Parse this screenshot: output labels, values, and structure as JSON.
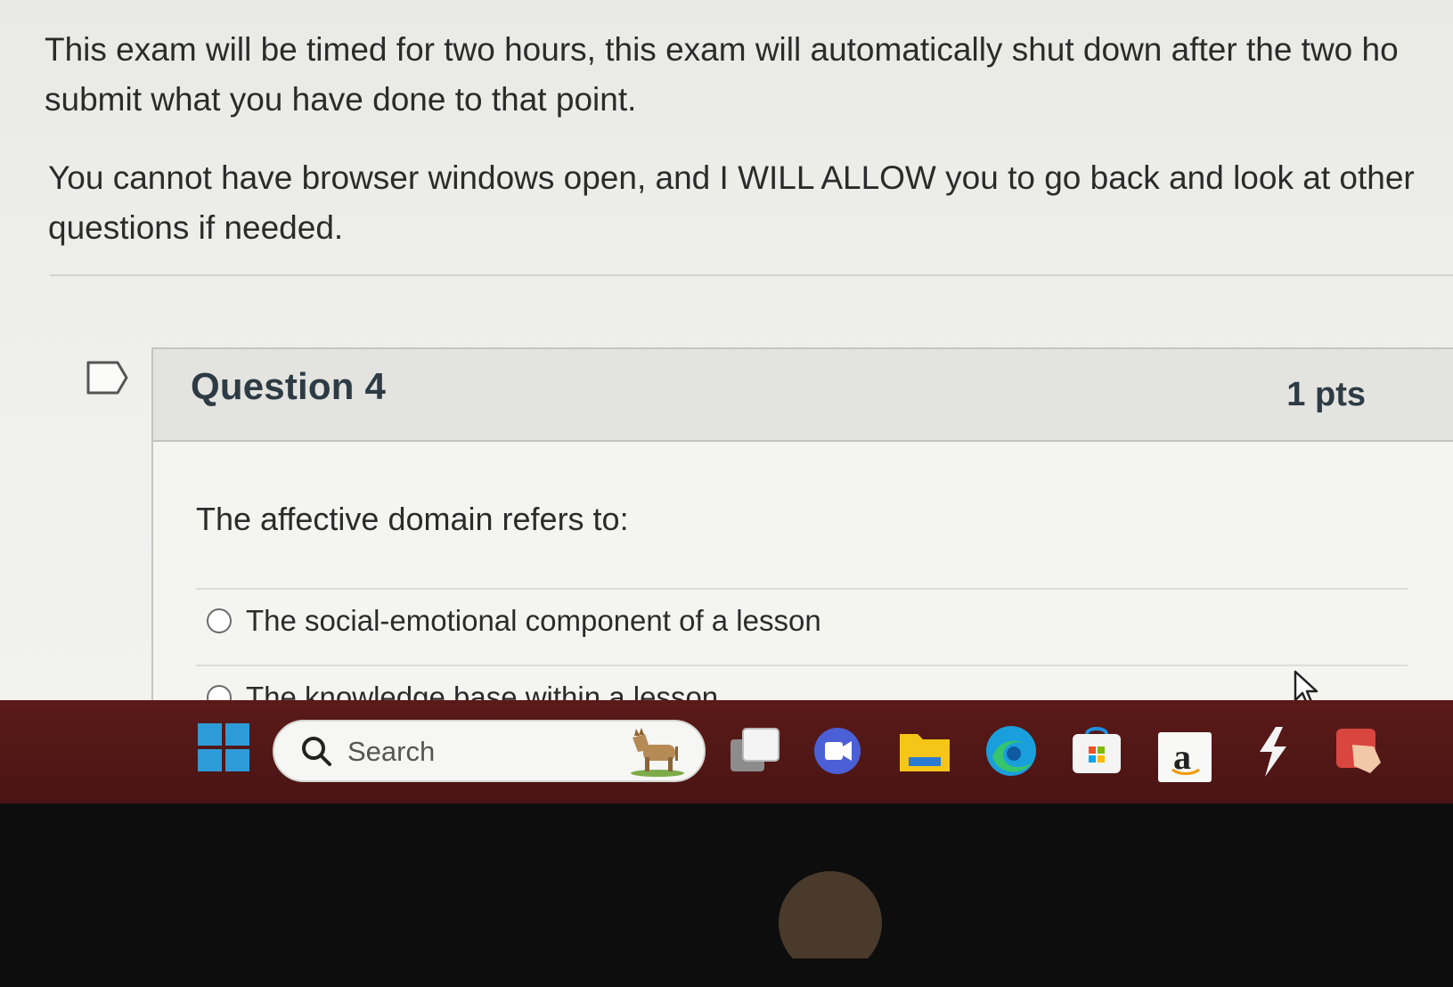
{
  "instructions": {
    "paragraph_1_line_1": "This exam will be timed for two hours, this exam will automatically shut down after the two ho",
    "paragraph_1_line_2": "submit what you have done to that point.",
    "paragraph_2_line_1": "You cannot have browser windows open, and I WILL ALLOW you to go back and look at other",
    "paragraph_2_line_2": "questions if needed."
  },
  "question": {
    "title": "Question 4",
    "points": "1 pts",
    "text": "The affective domain refers to:",
    "answers": [
      {
        "label": "The social-emotional component of a lesson"
      },
      {
        "label": "The knowledge base within a lesson"
      }
    ]
  },
  "taskbar": {
    "search_placeholder": "Search",
    "icons": [
      "windows-start-icon",
      "search-icon",
      "search-highlight-donkey-icon",
      "task-view-icon",
      "meet-video-icon",
      "file-explorer-icon",
      "edge-browser-icon",
      "microsoft-store-icon",
      "amazon-icon",
      "lightning-app-icon",
      "pinned-app-icon"
    ],
    "amazon_label": "a"
  },
  "colors": {
    "taskbar": "#4a1514",
    "question_header": "#e3e3df",
    "heading_text": "#2d3b45",
    "windows_accent": "#2e9bd9"
  }
}
